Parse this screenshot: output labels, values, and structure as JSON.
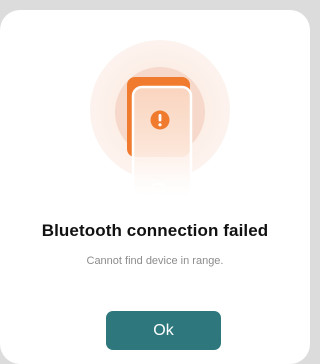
{
  "dialog": {
    "icon": "phone-warning-icon",
    "title": "Bluetooth connection failed",
    "message": "Cannot find device in range.",
    "ok_label": "Ok"
  },
  "colors": {
    "accent": "#f07a2e",
    "button": "#2e787d",
    "halo_outer": "#fdf1ea",
    "halo_inner": "#f9ddcd"
  }
}
